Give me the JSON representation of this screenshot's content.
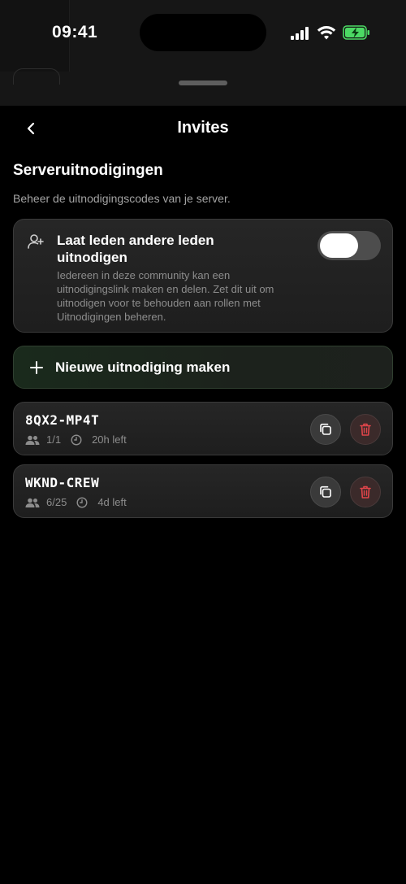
{
  "status_bar": {
    "time": "09:41"
  },
  "nav": {
    "title": "Invites"
  },
  "section": {
    "title": "Serveruitnodigingen",
    "subtitle": "Beheer de uitnodigingscodes van je server."
  },
  "member_invites": {
    "title": "Laat leden andere leden uitnodigen",
    "description": "Iedereen in deze community kan een uitnodigingslink maken en delen. Zet dit uit om uitnodigen voor te behouden aan rollen met Uitnodigingen beheren.",
    "enabled": true
  },
  "new_invite": {
    "label": "Nieuwe uitnodiging maken"
  },
  "invites": [
    {
      "code": "8QX2-MP4T",
      "uses": "1/1",
      "expires": "20h left"
    },
    {
      "code": "WKND-CREW",
      "uses": "6/25",
      "expires": "4d left"
    }
  ],
  "colors": {
    "background": "#000000",
    "card": "#222222",
    "accent_green": "#4cd964",
    "delete_red": "#e0454a",
    "muted_text": "#8d8d8d"
  },
  "icons": {
    "back": "chevron-left-icon",
    "add_member": "user-plus-icon",
    "plus": "plus-icon",
    "members": "users-icon",
    "clock": "clock-icon",
    "copy": "copy-icon",
    "delete": "trash-icon"
  }
}
